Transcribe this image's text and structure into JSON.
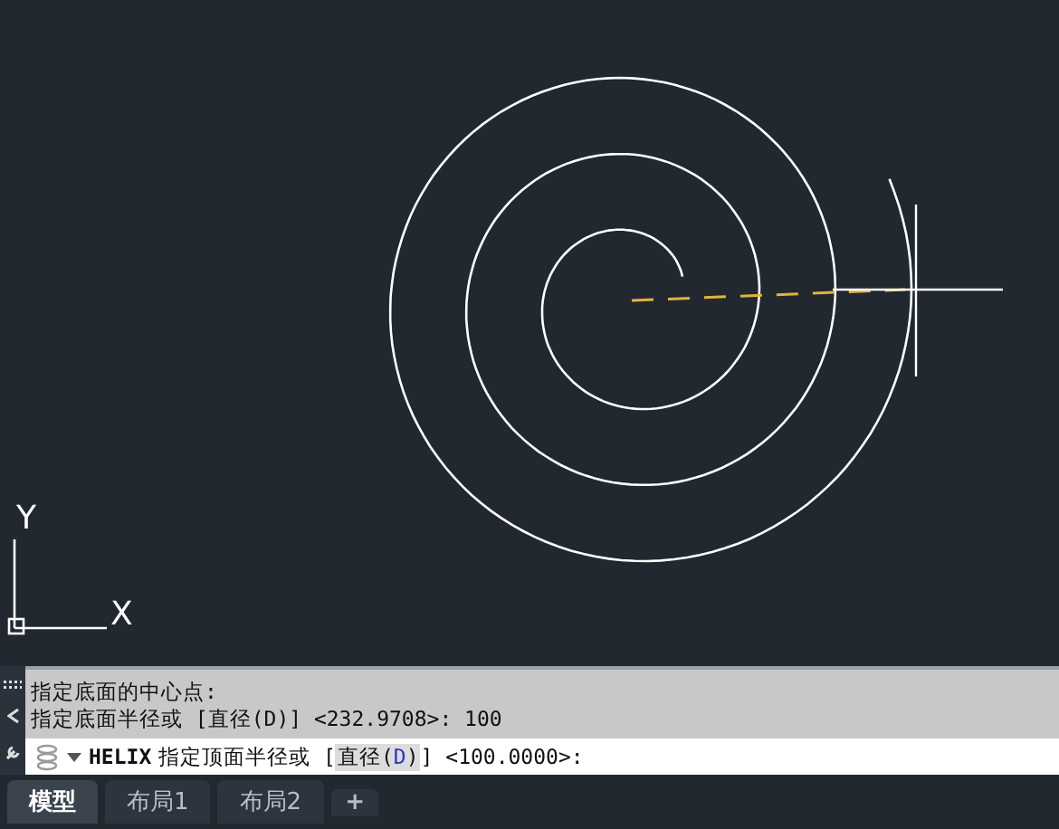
{
  "ucs": {
    "x_label": "X",
    "y_label": "Y"
  },
  "history": [
    "指定底面的中心点:",
    "指定底面半径或 [直径(D)] <232.9708>: 100"
  ],
  "command": {
    "name": "HELIX",
    "prompt": "指定顶面半径或 [",
    "option": {
      "label": "直径(",
      "key": "D",
      "close": ")"
    },
    "suffix": "] <100.0000>:"
  },
  "tabs": [
    {
      "label": "模型",
      "selected": true
    },
    {
      "label": "布局1",
      "selected": false
    },
    {
      "label": "布局2",
      "selected": false
    }
  ],
  "add_tab": "+"
}
